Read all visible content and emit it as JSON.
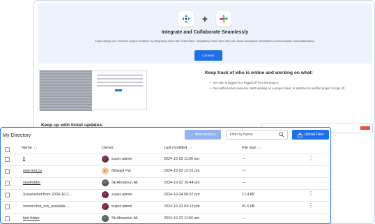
{
  "hero": {
    "title": "Integrate and Collaborate Seamlessly",
    "subtitle": "Supercharge your real-time project workflow by integrating Slack with TeamTrace. Integrating TeamTrace with your Slack workspace streamlines communication and collaboration.",
    "plus": "+",
    "connect_label": "Connect",
    "icons": [
      "teamtrace-logo-icon",
      "slack-logo-icon"
    ]
  },
  "online": {
    "title": "Keep track of who is online and working on what:",
    "bullets": [
      "See who is logged in or logged off from the project.",
      "Get notified when someone starts working on a project ticket, or switches to another project or logs off."
    ]
  },
  "tickets": {
    "title": "Keep up with ticket updates:"
  },
  "directory": {
    "title": "My Directory",
    "more_actions": "More Actions",
    "filter_placeholder": "Filter by Name",
    "upload_label": "Upload Files",
    "columns": {
      "name": "Name",
      "owner": "Owner",
      "modified": "Last modified",
      "size": "File size"
    },
    "sort_glyph": "↑↓",
    "rows": [
      {
        "name": "[]",
        "owner": "super admin",
        "modified": "2024-10-23 11:06 am",
        "size": "---",
        "avatar": "dark",
        "link": true,
        "menu": true
      },
      {
        "name": "new text.cs",
        "owner": "Biswajit Pal",
        "modified": "2024-10-22 12:01 pm",
        "size": "---",
        "avatar": "orange",
        "link": true,
        "menu": false
      },
      {
        "name": "newFolder",
        "owner": "Sk Almamun Ali",
        "modified": "2024-10-22 10:44 am",
        "size": "---",
        "avatar": "grey",
        "link": true,
        "menu": false
      },
      {
        "name": "Screenshot from 2024-10-1...",
        "owner": "super admin",
        "modified": "2024-10-24 06:57 pm",
        "size": "11.4 kB",
        "avatar": "dark",
        "link": false,
        "menu": true
      },
      {
        "name": "screenshot_not_available ...",
        "owner": "super admin",
        "modified": "2024-10-23 04:13 pm",
        "size": "91.6 kB",
        "avatar": "dark",
        "link": false,
        "menu": true
      },
      {
        "name": "test folder",
        "owner": "Sk Almamun Ali",
        "modified": "2024-10-22 11:56 am",
        "size": "---",
        "avatar": "grey",
        "link": true,
        "menu": false
      }
    ],
    "avatar_initials": {
      "orange": "BP"
    }
  }
}
